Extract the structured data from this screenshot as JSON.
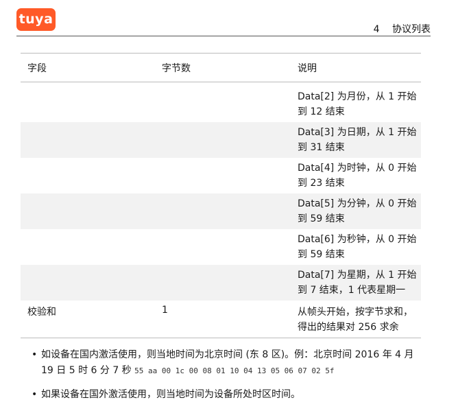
{
  "logo": {
    "text": "tuya",
    "color": "#ff5a28"
  },
  "header": {
    "section_number": "4",
    "section_title": "协议列表"
  },
  "table": {
    "columns": [
      "字段",
      "字节数",
      "说明"
    ],
    "rows": [
      {
        "field": "",
        "bytes": "",
        "desc_lines": [
          "Data[2] 为月份，从 1 开始",
          "到 12 结束"
        ]
      },
      {
        "field": "",
        "bytes": "",
        "desc_lines": [
          "Data[3] 为日期，从 1 开始",
          "到 31 结束"
        ]
      },
      {
        "field": "",
        "bytes": "",
        "desc_lines": [
          "Data[4] 为时钟，从 0 开始",
          "到 23 结束"
        ]
      },
      {
        "field": "",
        "bytes": "",
        "desc_lines": [
          "Data[5] 为分钟，从 0 开始",
          "到 59 结束"
        ]
      },
      {
        "field": "",
        "bytes": "",
        "desc_lines": [
          "Data[6] 为秒钟，从 0 开始",
          "到 59 结束"
        ]
      },
      {
        "field": "",
        "bytes": "",
        "desc_lines": [
          "Data[7] 为星期，从 1 开始",
          "到 7 结束，1 代表星期一"
        ]
      },
      {
        "field": "校验和",
        "bytes": "1",
        "desc_lines": [
          "从帧头开始，按字节求和，",
          "得出的结果对 256 求余"
        ]
      }
    ]
  },
  "bullets": [
    {
      "text_line1": "如设备在国内激活使用，则当地时间为北京时间 (东 8 区)。例：北京时间 2016 年 4 月",
      "text_line2": "19 日 5 时 6 分 7 秒",
      "code": "55 aa 00 1c 00 08 01 10 04 13 05 06 07 02 5f"
    },
    {
      "text_line1": "如果设备在国外激活使用，则当地时间为设备所处时区时间。"
    }
  ]
}
